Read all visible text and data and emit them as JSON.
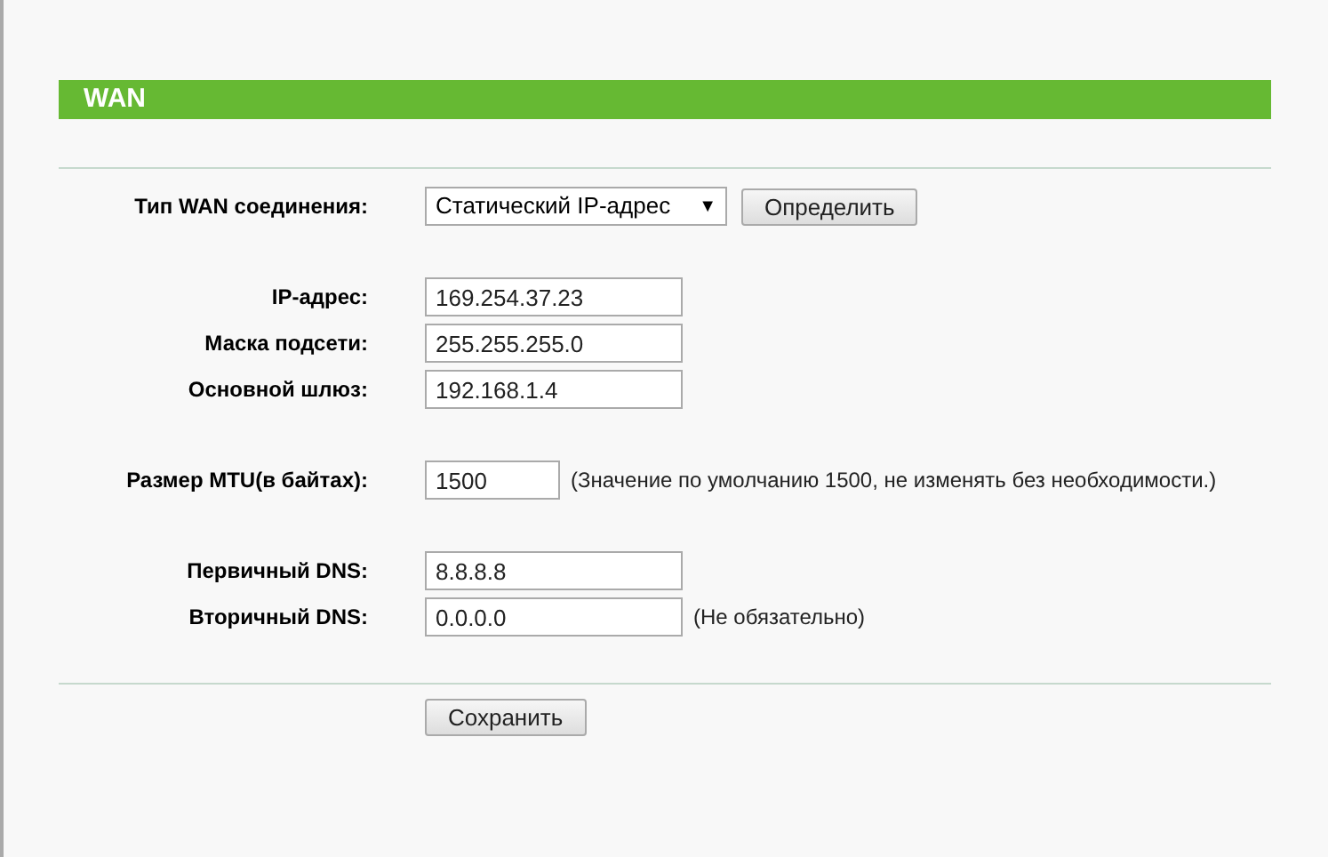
{
  "header": {
    "title": "WAN"
  },
  "groups": [
    {
      "rows": [
        {
          "kind": "select",
          "label": "Тип WAN соединения:",
          "value": "Статический IP-адрес",
          "arrow": "▼",
          "button": "Определить"
        }
      ]
    },
    {
      "rows": [
        {
          "kind": "text",
          "label": "IP-адрес:",
          "value": "169.254.37.23"
        },
        {
          "kind": "text",
          "label": "Маска подсети:",
          "value": "255.255.255.0"
        },
        {
          "kind": "text",
          "label": "Основной шлюз:",
          "value": "192.168.1.4"
        }
      ]
    },
    {
      "rows": [
        {
          "kind": "number",
          "label": "Размер MTU(в байтах):",
          "value": "1500",
          "hint": "(Значение по умолчанию 1500, не изменять без необходимости.)"
        }
      ]
    },
    {
      "rows": [
        {
          "kind": "text",
          "label": "Первичный DNS:",
          "value": "8.8.8.8"
        },
        {
          "kind": "text",
          "label": "Вторичный DNS:",
          "value": "0.0.0.0",
          "hint": "(Не обязательно)"
        }
      ]
    }
  ],
  "save_button": "Сохранить"
}
